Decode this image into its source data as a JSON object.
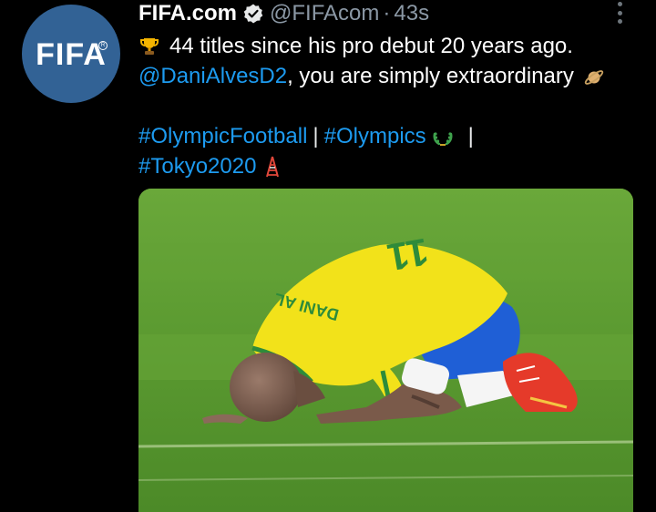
{
  "tweet": {
    "avatar_text": "FIFA",
    "display_name": "FIFA.com",
    "handle": "@FIFAcom",
    "separator": "·",
    "time": "43s",
    "line1_text": "44 titles since his pro debut 20 years ago.",
    "line2_mention": "@DaniAlvesD2",
    "line2_text": ", you are simply extraordinary",
    "hashtag1": "#OlympicFootball",
    "pipe": "|",
    "hashtag2": "#Olympics",
    "hashtag3": "#Tokyo2020",
    "jersey_name": "DANI AL"
  },
  "icons": {
    "verified": "verified-badge-icon",
    "more": "more-options-icon",
    "trophy": "trophy-emoji",
    "planet": "ringed-planet-emoji",
    "laurel": "laurel-wreath-emoji",
    "tower": "tokyo-tower-emoji"
  },
  "colors": {
    "background": "#000000",
    "link": "#1d9bf0",
    "secondary_text": "#8b98a5",
    "avatar_bg": "#326295",
    "pitch_green": "#5e9a2e",
    "jersey_yellow": "#f2e21a",
    "shorts_blue": "#1f5fd6"
  }
}
